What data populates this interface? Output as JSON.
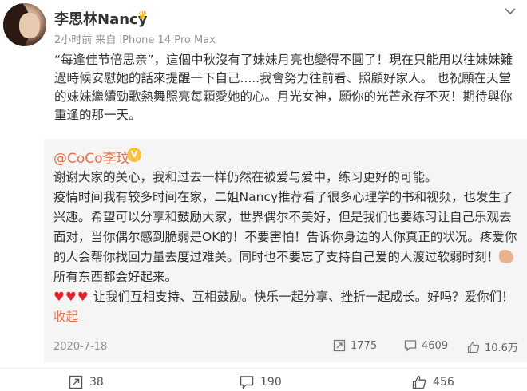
{
  "user": {
    "name": "李思林Nancy",
    "meta": "2小时前  来自 iPhone 14 Pro Max"
  },
  "post": {
    "text": "“每逢佳节倍思亲”，這個中秋沒有了妹妹月亮也變得不圓了！現在只能用以往妹妹難過時候安慰她的話來提醒一下自己.....我會努力往前看、照顧好家人。 也祝願在天堂的妹妹繼續勁歌熱舞照亮每顆愛她的心。月光女神，願你的光芒永存不灭！期待與你重逢的那一天。"
  },
  "repost": {
    "author": "@CoCo李玟",
    "badge": "V",
    "para1": "谢谢大家的关心，我和过去一样仍然在被爱与爱中，练习更好的可能。",
    "para2": "疫情时间我有较多时间在家，二姐Nancy推荐看了很多心理学的书和视频，也发生了兴趣。希望可以分享和鼓励大家，世界偶尔不美好，但是我们也要练习让自己乐观去面对，当你偶尔感到脆弱是OK的！不要害怕！告诉你身边的人你真正的状况。疼爱你的人会帮你找回力量去度过难关。同时也不要忘了支持自己爱的人渡过软弱时刻！",
    "para2_end": " 所有东西都会好起来。",
    "hearts": "♥♥♥",
    "para3": "   让我们互相支持、互相鼓励。快乐一起分享、挫折一起成长。好吗？爱你们！",
    "collapse": "收起",
    "date": "2020-7-18",
    "reposts": "1775",
    "comments": "4609",
    "likes": "10.6万"
  },
  "footer": {
    "reposts": "38",
    "comments": "190",
    "likes": "456"
  },
  "icons": {
    "more": "chevron-down-icon",
    "repost": "repost-icon",
    "comment": "comment-icon",
    "like": "thumbs-up-icon"
  },
  "colors": {
    "link": "#eb7350",
    "repost_bg": "#f5f5f5",
    "meta": "#939393"
  }
}
